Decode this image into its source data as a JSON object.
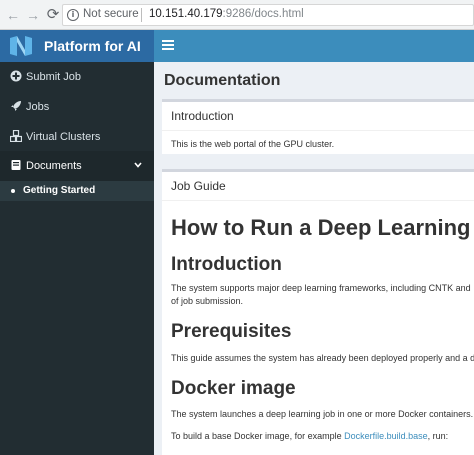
{
  "browser": {
    "security_label": "Not secure",
    "url_host": "10.151.40.179",
    "url_rest": ":9286/docs.html"
  },
  "header": {
    "brand": "Platform for AI"
  },
  "sidebar": {
    "items": [
      {
        "label": "Submit Job",
        "icon": "plus-circle-icon"
      },
      {
        "label": "Jobs",
        "icon": "rocket-icon"
      },
      {
        "label": "Virtual Clusters",
        "icon": "cubes-icon"
      },
      {
        "label": "Documents",
        "icon": "book-icon",
        "active": true
      }
    ],
    "subitems": [
      {
        "label": "Getting Started"
      }
    ]
  },
  "content": {
    "page_title": "Documentation",
    "intro_box": {
      "title": "Introduction",
      "text": "This is the web portal of the GPU cluster."
    },
    "job_guide": {
      "title": "Job Guide",
      "h1": "How to Run a Deep Learning Job",
      "sections": [
        {
          "heading": "Introduction",
          "text": [
            "The system supports major deep learning frameworks, including CNTK and",
            "of job submission."
          ]
        },
        {
          "heading": "Prerequisites",
          "text": [
            "This guide assumes the system has already been deployed properly and a d"
          ]
        },
        {
          "heading": "Docker image",
          "text": [
            "The system launches a deep learning job in one or more Docker containers."
          ]
        }
      ],
      "docker_build_prefix": "To build a base Docker image, for example ",
      "docker_build_link": "Dockerfile.build.base",
      "docker_build_suffix": ", run:"
    }
  },
  "colors": {
    "brand_bg": "#2c6aa3",
    "topbar_bg": "#3c8dbc",
    "sidebar_bg": "#222d32",
    "link": "#3c8dbc"
  }
}
